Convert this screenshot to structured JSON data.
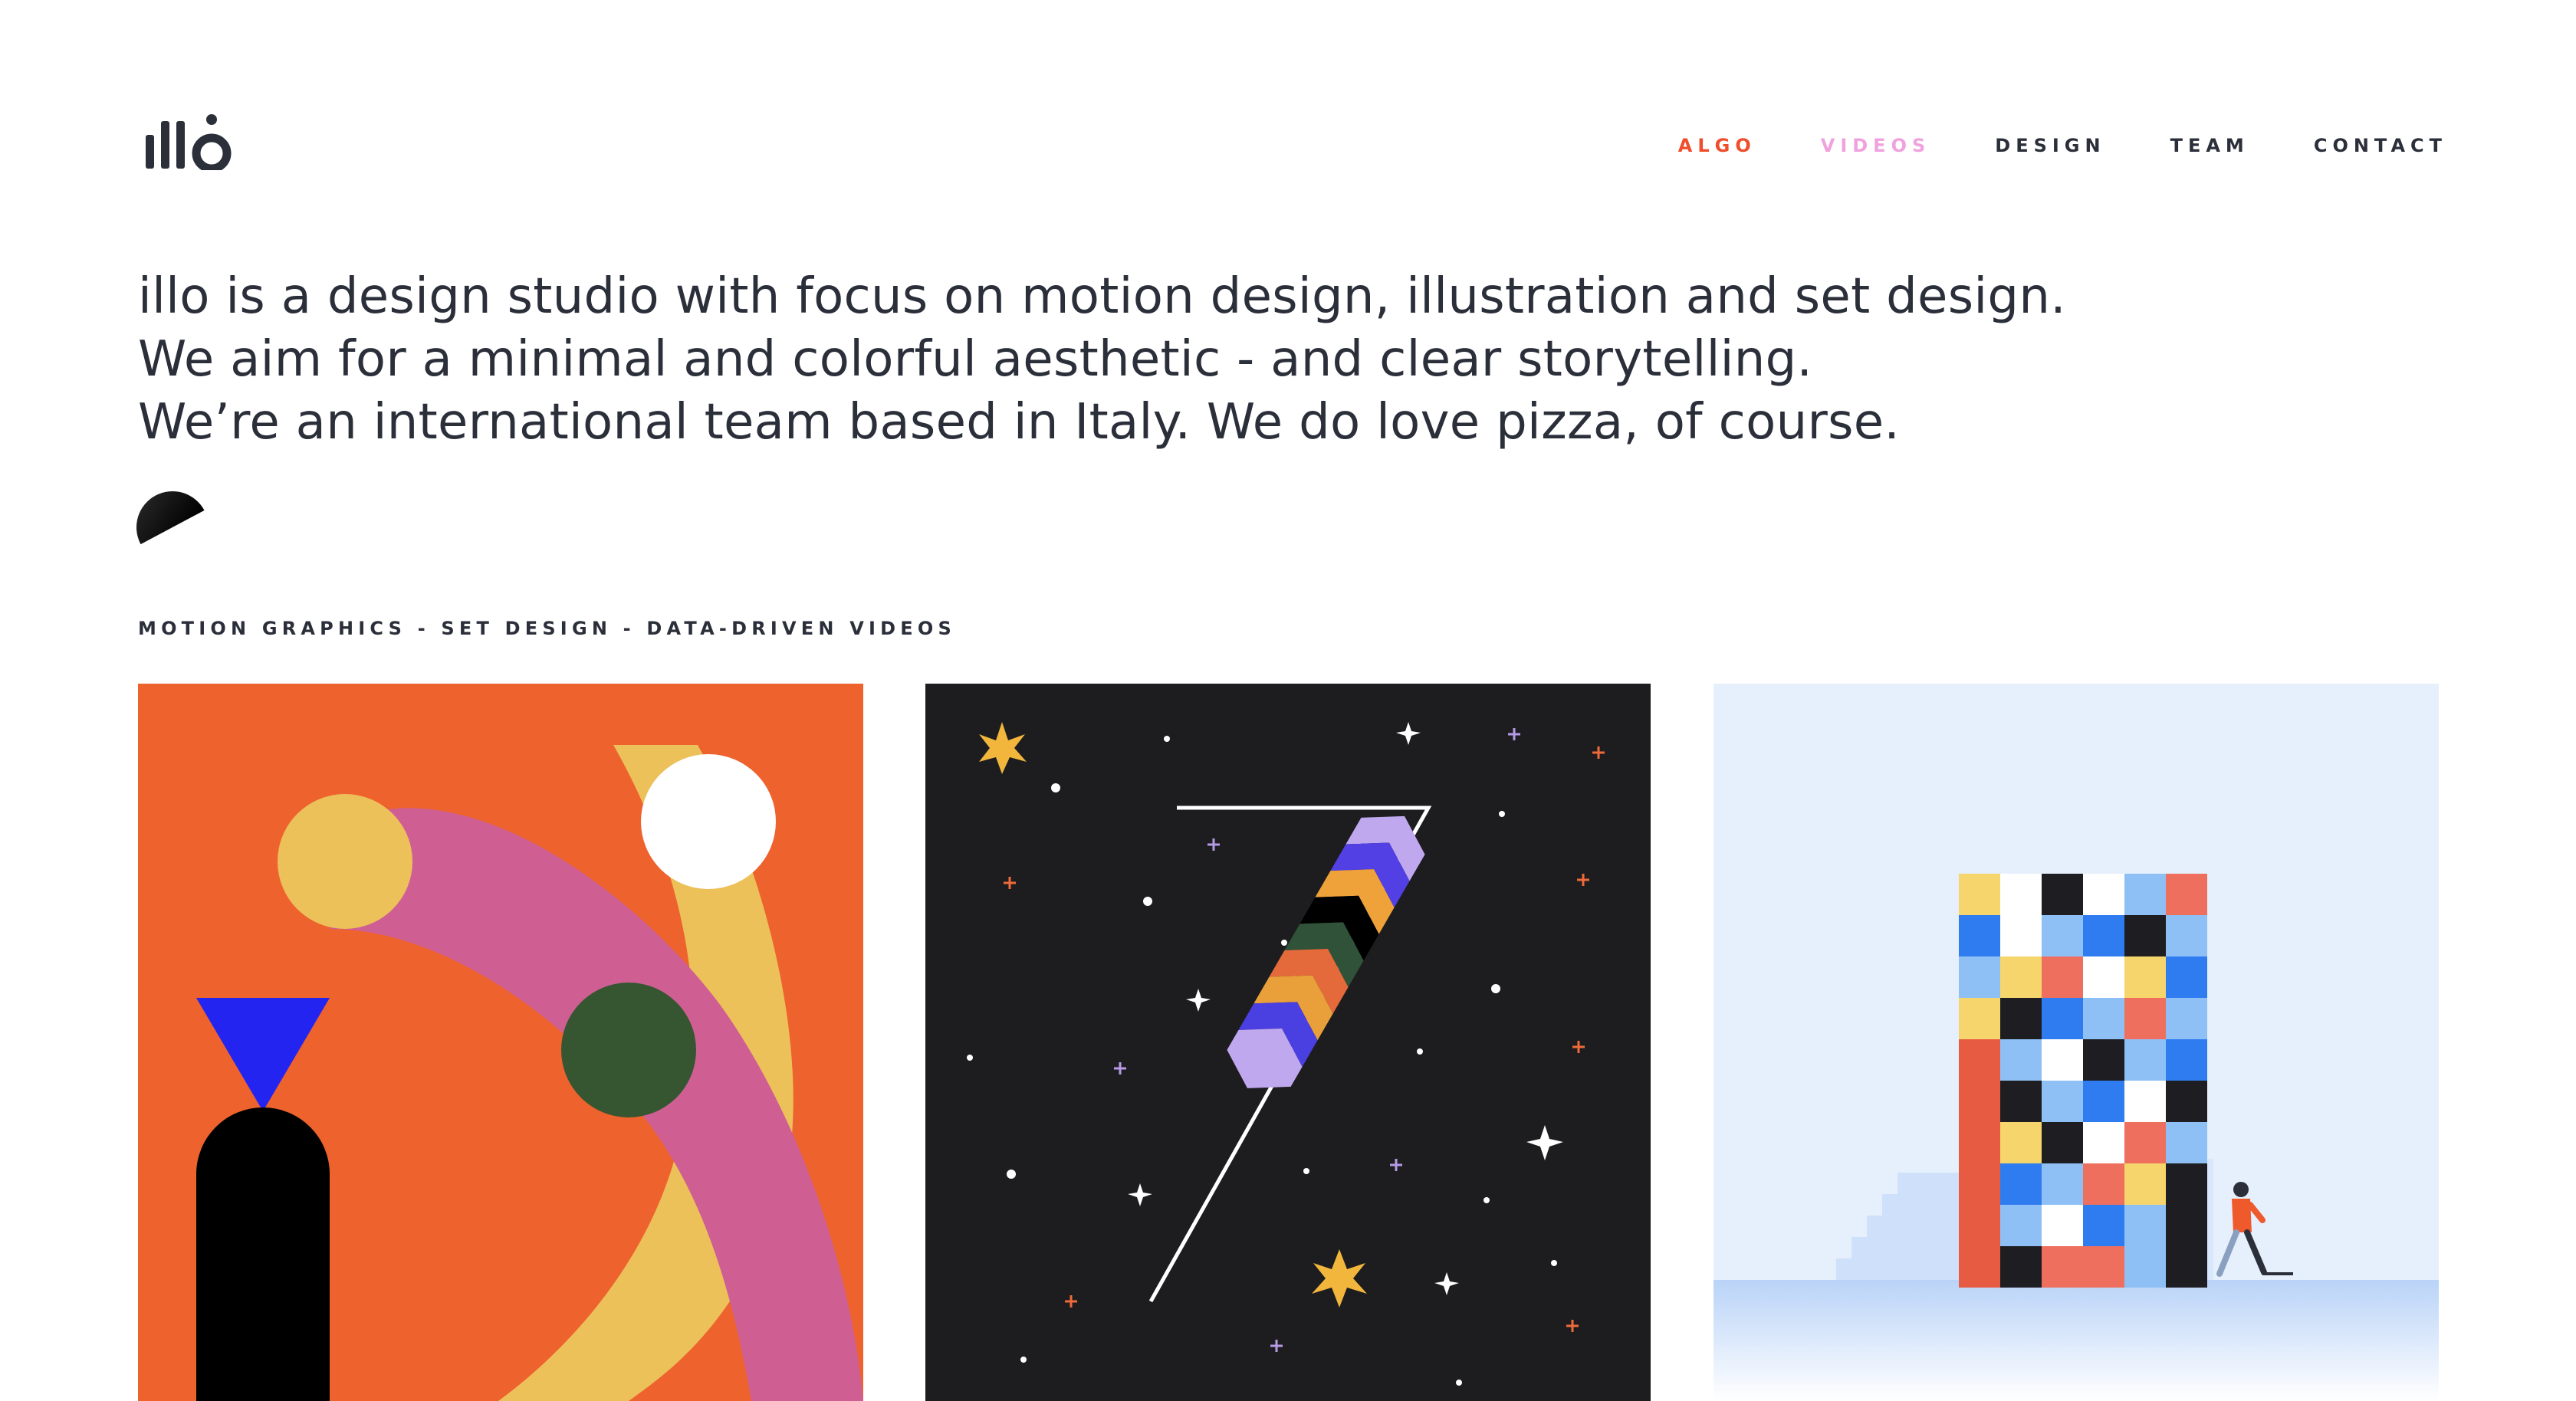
{
  "brand": {
    "logo_text": "illo"
  },
  "nav": {
    "items": [
      {
        "label": "ALGO",
        "color": "#ef4e2d"
      },
      {
        "label": "VIDEOS",
        "color": "#f0a2de"
      },
      {
        "label": "DESIGN",
        "color": "#2b2f3a"
      },
      {
        "label": "TEAM",
        "color": "#2b2f3a"
      },
      {
        "label": "CONTACT",
        "color": "#2b2f3a"
      }
    ]
  },
  "intro": {
    "lines": [
      "illo is a design studio with focus on motion design, illustration and set design.",
      "We aim for a minimal and colorful aesthetic - and clear storytelling.",
      "We’re an international team based in Italy. We do love pizza, of course."
    ]
  },
  "services_line": "MOTION GRAPHICS - SET DESIGN - DATA-DRIVEN VIDEOS",
  "portfolio": {
    "tiles": [
      {
        "icon": "abstract-shapes-artwork",
        "background": "#ee622d"
      },
      {
        "icon": "number-seven-night-sky-artwork",
        "background": "#1d1d1f"
      },
      {
        "icon": "colorful-tower-walker-artwork",
        "background": "#e6f0fc"
      }
    ]
  },
  "colors": {
    "text": "#2b2f3a",
    "accent_orange": "#ef4e2d",
    "accent_pink": "#f0a2de"
  }
}
